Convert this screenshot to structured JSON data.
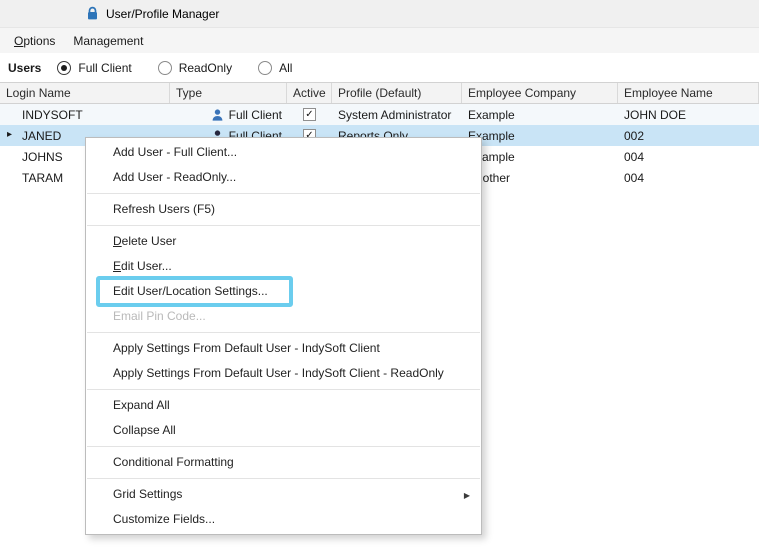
{
  "window": {
    "title": "User/Profile Manager"
  },
  "menubar": {
    "options": {
      "accel": "O",
      "rest": "ptions"
    },
    "management": {
      "label": "Management"
    }
  },
  "filter": {
    "label": "Users",
    "options": [
      {
        "label": "Full Client",
        "selected": true
      },
      {
        "label": "ReadOnly",
        "selected": false
      },
      {
        "label": "All",
        "selected": false
      }
    ]
  },
  "grid": {
    "columns": [
      "Login Name",
      "Type",
      "Active",
      "Profile (Default)",
      "Employee Company",
      "Employee Name"
    ],
    "rows": [
      {
        "login": "INDYSOFT",
        "type": "Full Client",
        "type_icon": "user-icon",
        "type_icon_color": "#3a74b9",
        "active": true,
        "profile": "System Administrator",
        "company": "Example",
        "name": "JOHN DOE",
        "selected": false
      },
      {
        "login": "JANED",
        "type": "Full Client",
        "type_icon": "user-icon",
        "type_icon_color": "#26263e",
        "active": true,
        "profile": "Reports Only",
        "company": "Example",
        "name": "002",
        "selected": true
      },
      {
        "login": "JOHNS",
        "type": "",
        "active": null,
        "profile": "",
        "company": "Example",
        "name": "004",
        "selected": false
      },
      {
        "login": "TARAM",
        "type": "",
        "active": null,
        "profile": "",
        "company": "Another",
        "name": "004",
        "selected": false
      }
    ]
  },
  "context_menu": {
    "items": [
      {
        "label": "Add User - Full Client..."
      },
      {
        "label": "Add User - ReadOnly..."
      },
      {
        "separator": true
      },
      {
        "label": "Refresh Users (F5)"
      },
      {
        "separator": true
      },
      {
        "accel": "D",
        "rest": "elete User"
      },
      {
        "accel": "E",
        "rest": "dit User..."
      },
      {
        "label": "Edit User/Location Settings...",
        "highlighted": true
      },
      {
        "label": "Email Pin Code...",
        "disabled": true
      },
      {
        "separator": true
      },
      {
        "label": "Apply Settings From Default User - IndySoft Client"
      },
      {
        "label": "Apply Settings From Default User - IndySoft Client - ReadOnly"
      },
      {
        "separator": true
      },
      {
        "label": "Expand All"
      },
      {
        "label": "Collapse All"
      },
      {
        "separator": true
      },
      {
        "label": "Conditional Formatting"
      },
      {
        "separator": true
      },
      {
        "label": "Grid Settings",
        "submenu": true
      },
      {
        "label": "Customize Fields..."
      }
    ]
  },
  "icons": {
    "submenu_arrow": "▶",
    "row_indicator": "▸",
    "check": "✓"
  },
  "colors": {
    "highlight_border": "#6bcdee",
    "selected_row": "#c9e4f6"
  }
}
